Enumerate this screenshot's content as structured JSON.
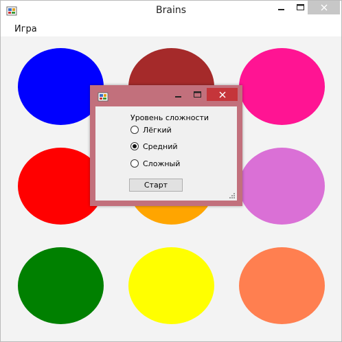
{
  "window": {
    "title": "Brains",
    "minimize": "🗕",
    "maximize": "🗖",
    "close": "✕"
  },
  "menu": {
    "items": [
      "Игра"
    ]
  },
  "colors": {
    "circles": [
      "#0000ff",
      "#a52a2a",
      "#ff1493",
      "#ff0000",
      "#ffa500",
      "#da70d6",
      "#008000",
      "#ffff00",
      "#ff7f50"
    ]
  },
  "dialog": {
    "close": "✕",
    "label": "Уровень сложности",
    "options": [
      {
        "label": "Лёгкий",
        "checked": false
      },
      {
        "label": "Средний",
        "checked": true
      },
      {
        "label": "Сложный",
        "checked": false
      }
    ],
    "start_label": "Старт"
  }
}
